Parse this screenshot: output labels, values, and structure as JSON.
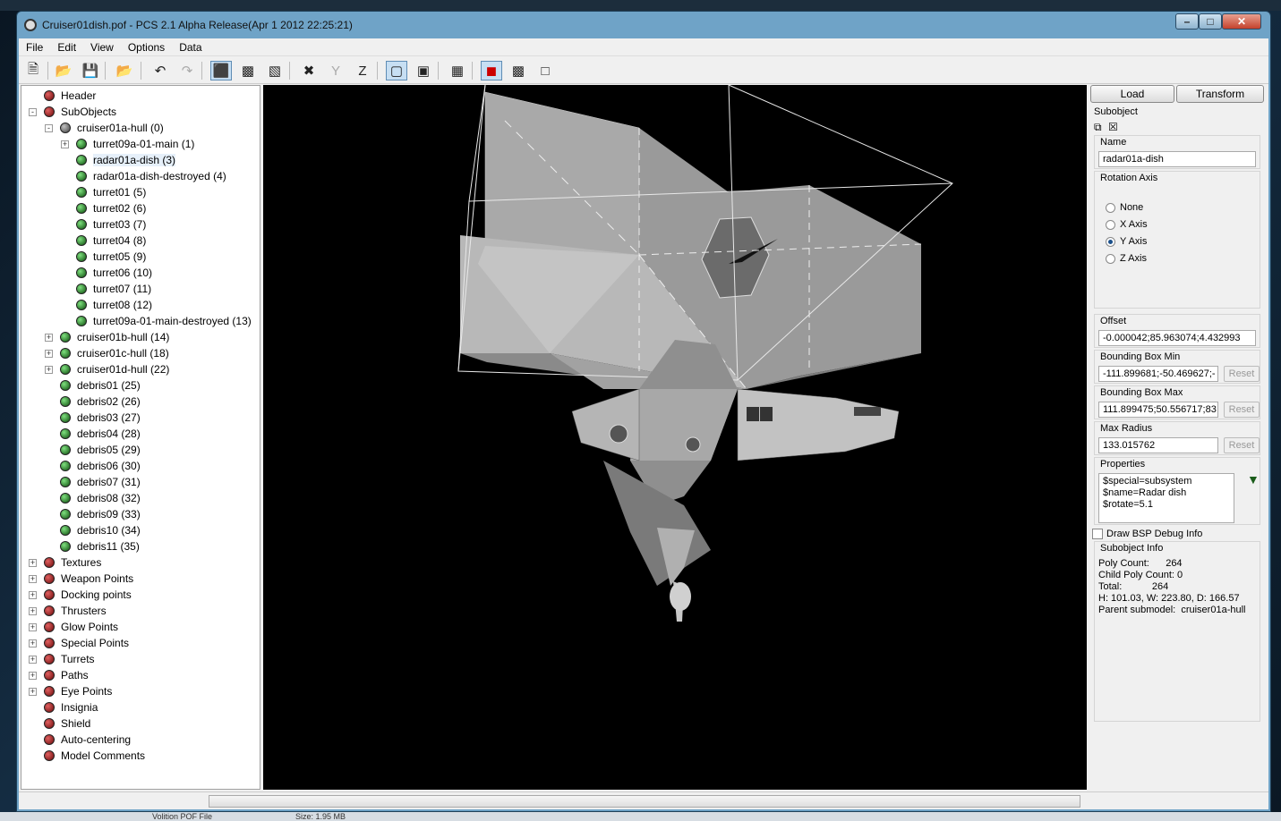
{
  "window": {
    "title": "Cruiser01dish.pof - PCS 2.1 Alpha Release(Apr  1 2012 22:25:21)",
    "minimize": "–",
    "maximize": "□",
    "close": "✕"
  },
  "menu": [
    "File",
    "Edit",
    "View",
    "Options",
    "Data"
  ],
  "toolbar": {
    "icons": [
      "new-file-icon",
      "open-folder-icon",
      "save-icon",
      "open-alt-icon",
      "undo-icon",
      "redo-icon",
      "solid-view-icon",
      "wire-solid-icon",
      "textured-view-icon",
      "axis-x-icon",
      "axis-y-icon",
      "axis-z-icon",
      "camera-a-icon",
      "camera-b-icon",
      "grid-icon",
      "color-cube-icon",
      "box-icon",
      "wire-box-icon"
    ]
  },
  "tree": [
    {
      "label": "Header",
      "depth": 0,
      "expander": "none",
      "ball": "red"
    },
    {
      "label": "SubObjects",
      "depth": 0,
      "expander": "-",
      "ball": "red"
    },
    {
      "label": "cruiser01a-hull (0)",
      "depth": 1,
      "expander": "-",
      "ball": "gray"
    },
    {
      "label": "turret09a-01-main (1)",
      "depth": 2,
      "expander": "+",
      "ball": "green"
    },
    {
      "label": "radar01a-dish (3)",
      "depth": 2,
      "expander": "none",
      "ball": "green",
      "selected": true
    },
    {
      "label": "radar01a-dish-destroyed (4)",
      "depth": 2,
      "expander": "none",
      "ball": "green"
    },
    {
      "label": "turret01 (5)",
      "depth": 2,
      "expander": "none",
      "ball": "green"
    },
    {
      "label": "turret02 (6)",
      "depth": 2,
      "expander": "none",
      "ball": "green"
    },
    {
      "label": "turret03 (7)",
      "depth": 2,
      "expander": "none",
      "ball": "green"
    },
    {
      "label": "turret04 (8)",
      "depth": 2,
      "expander": "none",
      "ball": "green"
    },
    {
      "label": "turret05 (9)",
      "depth": 2,
      "expander": "none",
      "ball": "green"
    },
    {
      "label": "turret06 (10)",
      "depth": 2,
      "expander": "none",
      "ball": "green"
    },
    {
      "label": "turret07 (11)",
      "depth": 2,
      "expander": "none",
      "ball": "green"
    },
    {
      "label": "turret08 (12)",
      "depth": 2,
      "expander": "none",
      "ball": "green"
    },
    {
      "label": "turret09a-01-main-destroyed (13)",
      "depth": 2,
      "expander": "none",
      "ball": "green"
    },
    {
      "label": "cruiser01b-hull (14)",
      "depth": 1,
      "expander": "+",
      "ball": "green"
    },
    {
      "label": "cruiser01c-hull (18)",
      "depth": 1,
      "expander": "+",
      "ball": "green"
    },
    {
      "label": "cruiser01d-hull (22)",
      "depth": 1,
      "expander": "+",
      "ball": "green"
    },
    {
      "label": "debris01 (25)",
      "depth": 1,
      "expander": "none",
      "ball": "green"
    },
    {
      "label": "debris02 (26)",
      "depth": 1,
      "expander": "none",
      "ball": "green"
    },
    {
      "label": "debris03 (27)",
      "depth": 1,
      "expander": "none",
      "ball": "green"
    },
    {
      "label": "debris04 (28)",
      "depth": 1,
      "expander": "none",
      "ball": "green"
    },
    {
      "label": "debris05 (29)",
      "depth": 1,
      "expander": "none",
      "ball": "green"
    },
    {
      "label": "debris06 (30)",
      "depth": 1,
      "expander": "none",
      "ball": "green"
    },
    {
      "label": "debris07 (31)",
      "depth": 1,
      "expander": "none",
      "ball": "green"
    },
    {
      "label": "debris08 (32)",
      "depth": 1,
      "expander": "none",
      "ball": "green"
    },
    {
      "label": "debris09 (33)",
      "depth": 1,
      "expander": "none",
      "ball": "green"
    },
    {
      "label": "debris10 (34)",
      "depth": 1,
      "expander": "none",
      "ball": "green"
    },
    {
      "label": "debris11 (35)",
      "depth": 1,
      "expander": "none",
      "ball": "green"
    },
    {
      "label": "Textures",
      "depth": 0,
      "expander": "+",
      "ball": "red"
    },
    {
      "label": "Weapon Points",
      "depth": 0,
      "expander": "+",
      "ball": "red"
    },
    {
      "label": "Docking points",
      "depth": 0,
      "expander": "+",
      "ball": "red"
    },
    {
      "label": "Thrusters",
      "depth": 0,
      "expander": "+",
      "ball": "red"
    },
    {
      "label": "Glow Points",
      "depth": 0,
      "expander": "+",
      "ball": "red"
    },
    {
      "label": "Special Points",
      "depth": 0,
      "expander": "+",
      "ball": "red"
    },
    {
      "label": "Turrets",
      "depth": 0,
      "expander": "+",
      "ball": "red"
    },
    {
      "label": "Paths",
      "depth": 0,
      "expander": "+",
      "ball": "red"
    },
    {
      "label": "Eye Points",
      "depth": 0,
      "expander": "+",
      "ball": "red"
    },
    {
      "label": "Insignia",
      "depth": 0,
      "expander": "none",
      "ball": "red"
    },
    {
      "label": "Shield",
      "depth": 0,
      "expander": "none",
      "ball": "red"
    },
    {
      "label": "Auto-centering",
      "depth": 0,
      "expander": "none",
      "ball": "red"
    },
    {
      "label": "Model Comments",
      "depth": 0,
      "expander": "none",
      "ball": "red"
    }
  ],
  "panel": {
    "load_label": "Load",
    "transform_label": "Transform",
    "section_label": "Subobject",
    "name_label": "Name",
    "name_value": "radar01a-dish",
    "rotation_label": "Rotation Axis",
    "rotation_options": [
      "None",
      "X Axis",
      "Y Axis",
      "Z Axis"
    ],
    "rotation_selected": "Y Axis",
    "offset_label": "Offset",
    "offset_value": "-0.000042;85.963074;4.432993",
    "bbmin_label": "Bounding Box Min",
    "bbmin_value": "-111.899681;-50.469627;-",
    "bbmax_label": "Bounding Box Max",
    "bbmax_value": "111.899475;50.556717;83",
    "radius_label": "Max Radius",
    "radius_value": "133.015762",
    "reset_label": "Reset",
    "properties_label": "Properties",
    "properties_lines": [
      "$special=subsystem",
      "$name=Radar dish",
      "$rotate=5.1"
    ],
    "bsp_label": "Draw BSP Debug Info",
    "bsp_checked": false,
    "info_label": "Subobject Info",
    "info_lines": [
      "Poly Count:      264",
      "Child Poly Count: 0",
      "Total:           264",
      "H: 101.03, W: 223.80, D: 166.57",
      "Parent submodel:  cruiser01a-hull"
    ]
  },
  "taskbar_text": [
    "Volition POF File",
    "Size: 1.95 MB"
  ],
  "colors": {
    "accent": "#1a4f8a",
    "viewport_bg": "#000000",
    "window_frame": "#6fa3c7"
  }
}
